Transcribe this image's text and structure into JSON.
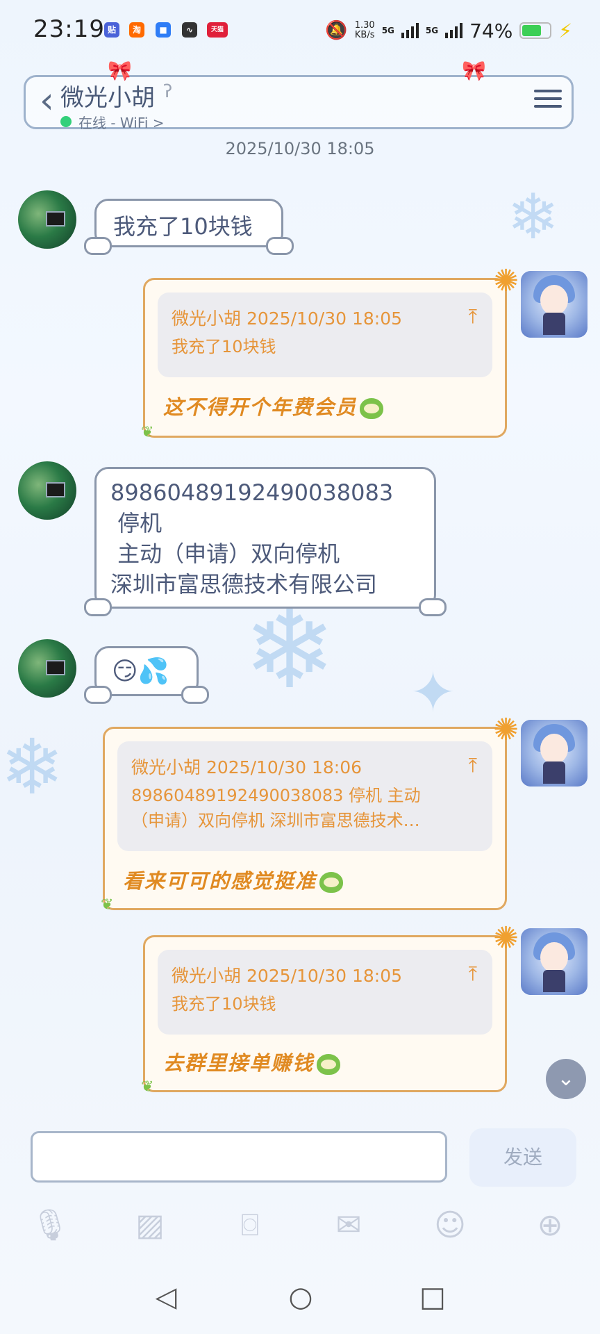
{
  "status_bar": {
    "time": "23:19",
    "app_icons": [
      "贴",
      "淘",
      "天猫"
    ],
    "net_speed_value": "1.30",
    "net_speed_unit": "KB/s",
    "signal_1": "5G",
    "signal_2": "5G",
    "battery_percent": "74%",
    "battery_level": 0.74
  },
  "header": {
    "contact_name": "微光小胡",
    "online_status": "在线 - WiFi >"
  },
  "chat": {
    "timestamp": "2025/10/30 18:05",
    "messages": [
      {
        "side": "left",
        "text": "我充了10块钱"
      },
      {
        "side": "right",
        "quote_header": "微光小胡 2025/10/30 18:05",
        "quote_body": "我充了10块钱",
        "reply": "这不得开个年费会员"
      },
      {
        "side": "left",
        "text": "89860489192490038083\n 停机\n 主动（申请）双向停机\n深圳市富思德技术有限公司"
      },
      {
        "side": "left",
        "text": "😏💦"
      },
      {
        "side": "right",
        "quote_header": "微光小胡 2025/10/30 18:06",
        "quote_body": "89860489192490038083  停机  主动\n（申请）双向停机 深圳市富思德技术…",
        "reply": "看来可可的感觉挺准"
      },
      {
        "side": "right",
        "quote_header": "微光小胡 2025/10/30 18:05",
        "quote_body": "我充了10块钱",
        "reply": "去群里接单赚钱"
      }
    ]
  },
  "input": {
    "placeholder": "",
    "send_label": "发送"
  },
  "toolbar": [
    "mic-icon",
    "image-icon",
    "camera-icon",
    "red-packet-icon",
    "emoji-icon",
    "plus-icon"
  ],
  "colors": {
    "accent_orange": "#e6953a",
    "bubble_border": "#8a96aa",
    "online_green": "#33d07a"
  }
}
